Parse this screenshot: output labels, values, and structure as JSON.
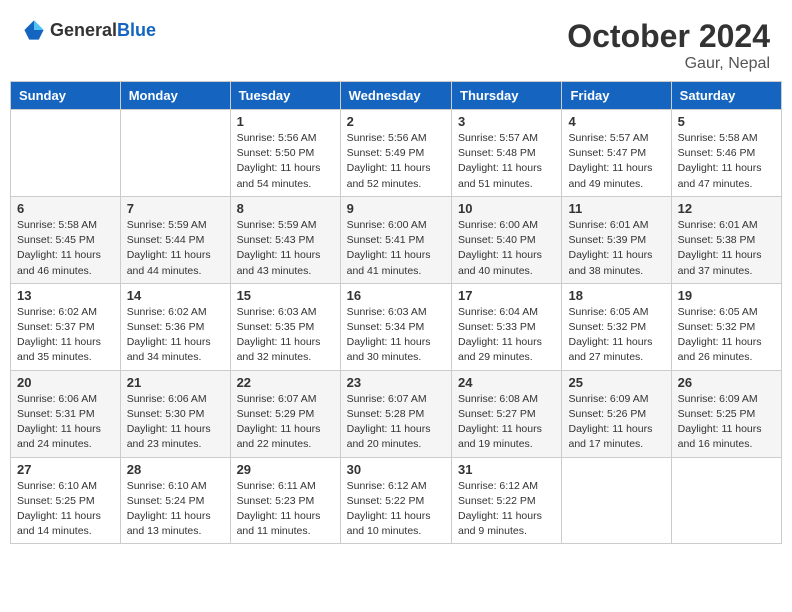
{
  "header": {
    "logo_general": "General",
    "logo_blue": "Blue",
    "month_title": "October 2024",
    "location": "Gaur, Nepal"
  },
  "weekdays": [
    "Sunday",
    "Monday",
    "Tuesday",
    "Wednesday",
    "Thursday",
    "Friday",
    "Saturday"
  ],
  "weeks": [
    [
      null,
      null,
      {
        "day": "1",
        "sunrise": "5:56 AM",
        "sunset": "5:50 PM",
        "daylight": "11 hours and 54 minutes."
      },
      {
        "day": "2",
        "sunrise": "5:56 AM",
        "sunset": "5:49 PM",
        "daylight": "11 hours and 52 minutes."
      },
      {
        "day": "3",
        "sunrise": "5:57 AM",
        "sunset": "5:48 PM",
        "daylight": "11 hours and 51 minutes."
      },
      {
        "day": "4",
        "sunrise": "5:57 AM",
        "sunset": "5:47 PM",
        "daylight": "11 hours and 49 minutes."
      },
      {
        "day": "5",
        "sunrise": "5:58 AM",
        "sunset": "5:46 PM",
        "daylight": "11 hours and 47 minutes."
      }
    ],
    [
      {
        "day": "6",
        "sunrise": "5:58 AM",
        "sunset": "5:45 PM",
        "daylight": "11 hours and 46 minutes."
      },
      {
        "day": "7",
        "sunrise": "5:59 AM",
        "sunset": "5:44 PM",
        "daylight": "11 hours and 44 minutes."
      },
      {
        "day": "8",
        "sunrise": "5:59 AM",
        "sunset": "5:43 PM",
        "daylight": "11 hours and 43 minutes."
      },
      {
        "day": "9",
        "sunrise": "6:00 AM",
        "sunset": "5:41 PM",
        "daylight": "11 hours and 41 minutes."
      },
      {
        "day": "10",
        "sunrise": "6:00 AM",
        "sunset": "5:40 PM",
        "daylight": "11 hours and 40 minutes."
      },
      {
        "day": "11",
        "sunrise": "6:01 AM",
        "sunset": "5:39 PM",
        "daylight": "11 hours and 38 minutes."
      },
      {
        "day": "12",
        "sunrise": "6:01 AM",
        "sunset": "5:38 PM",
        "daylight": "11 hours and 37 minutes."
      }
    ],
    [
      {
        "day": "13",
        "sunrise": "6:02 AM",
        "sunset": "5:37 PM",
        "daylight": "11 hours and 35 minutes."
      },
      {
        "day": "14",
        "sunrise": "6:02 AM",
        "sunset": "5:36 PM",
        "daylight": "11 hours and 34 minutes."
      },
      {
        "day": "15",
        "sunrise": "6:03 AM",
        "sunset": "5:35 PM",
        "daylight": "11 hours and 32 minutes."
      },
      {
        "day": "16",
        "sunrise": "6:03 AM",
        "sunset": "5:34 PM",
        "daylight": "11 hours and 30 minutes."
      },
      {
        "day": "17",
        "sunrise": "6:04 AM",
        "sunset": "5:33 PM",
        "daylight": "11 hours and 29 minutes."
      },
      {
        "day": "18",
        "sunrise": "6:05 AM",
        "sunset": "5:32 PM",
        "daylight": "11 hours and 27 minutes."
      },
      {
        "day": "19",
        "sunrise": "6:05 AM",
        "sunset": "5:32 PM",
        "daylight": "11 hours and 26 minutes."
      }
    ],
    [
      {
        "day": "20",
        "sunrise": "6:06 AM",
        "sunset": "5:31 PM",
        "daylight": "11 hours and 24 minutes."
      },
      {
        "day": "21",
        "sunrise": "6:06 AM",
        "sunset": "5:30 PM",
        "daylight": "11 hours and 23 minutes."
      },
      {
        "day": "22",
        "sunrise": "6:07 AM",
        "sunset": "5:29 PM",
        "daylight": "11 hours and 22 minutes."
      },
      {
        "day": "23",
        "sunrise": "6:07 AM",
        "sunset": "5:28 PM",
        "daylight": "11 hours and 20 minutes."
      },
      {
        "day": "24",
        "sunrise": "6:08 AM",
        "sunset": "5:27 PM",
        "daylight": "11 hours and 19 minutes."
      },
      {
        "day": "25",
        "sunrise": "6:09 AM",
        "sunset": "5:26 PM",
        "daylight": "11 hours and 17 minutes."
      },
      {
        "day": "26",
        "sunrise": "6:09 AM",
        "sunset": "5:25 PM",
        "daylight": "11 hours and 16 minutes."
      }
    ],
    [
      {
        "day": "27",
        "sunrise": "6:10 AM",
        "sunset": "5:25 PM",
        "daylight": "11 hours and 14 minutes."
      },
      {
        "day": "28",
        "sunrise": "6:10 AM",
        "sunset": "5:24 PM",
        "daylight": "11 hours and 13 minutes."
      },
      {
        "day": "29",
        "sunrise": "6:11 AM",
        "sunset": "5:23 PM",
        "daylight": "11 hours and 11 minutes."
      },
      {
        "day": "30",
        "sunrise": "6:12 AM",
        "sunset": "5:22 PM",
        "daylight": "11 hours and 10 minutes."
      },
      {
        "day": "31",
        "sunrise": "6:12 AM",
        "sunset": "5:22 PM",
        "daylight": "11 hours and 9 minutes."
      },
      null,
      null
    ]
  ],
  "labels": {
    "sunrise": "Sunrise:",
    "sunset": "Sunset:",
    "daylight": "Daylight:"
  }
}
